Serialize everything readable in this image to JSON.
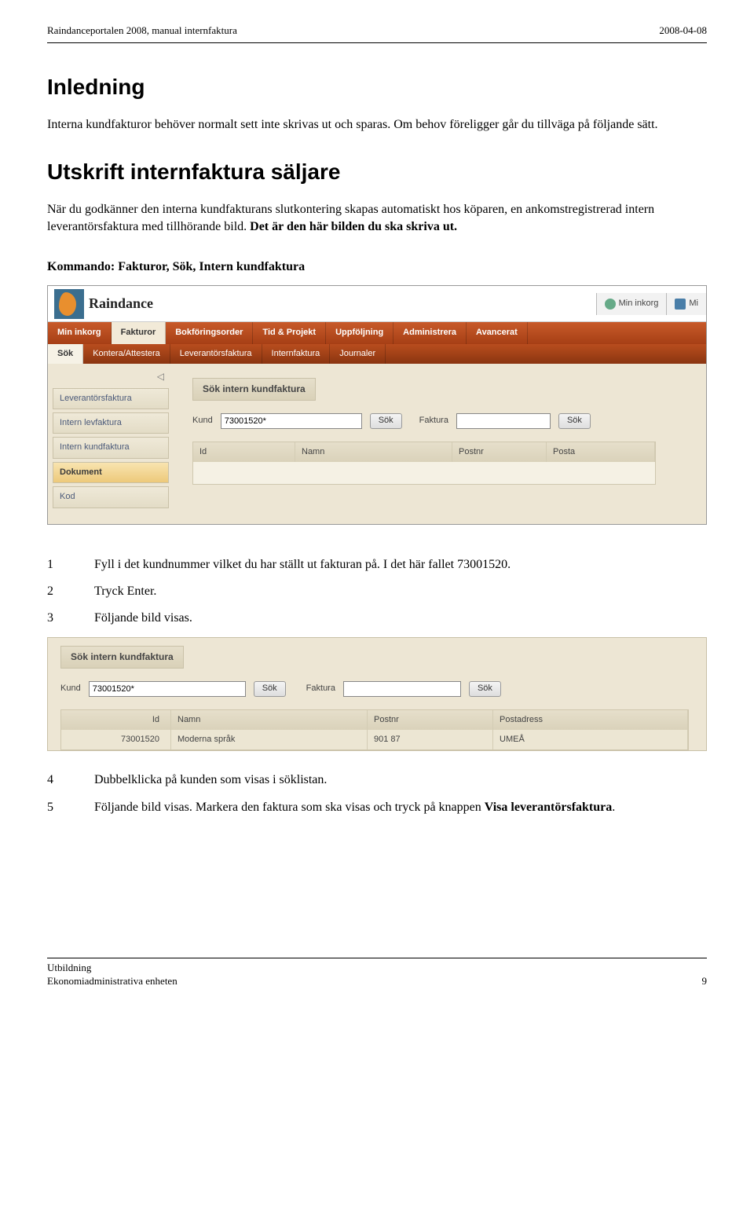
{
  "header": {
    "left": "Raindanceportalen 2008, manual internfaktura",
    "right": "2008-04-08"
  },
  "section1": {
    "title": "Inledning",
    "para": "Interna kundfakturor behöver normalt sett inte skrivas ut och sparas. Om behov föreligger går du tillväga på följande sätt."
  },
  "section2": {
    "title": "Utskrift internfaktura säljare",
    "para_a": "När du godkänner den interna kundfakturans slutkontering skapas automatiskt hos köparen, en ankomstregistrerad intern leverantörsfaktura med tillhörande bild. ",
    "para_b": "Det är den här bilden du ska skriva ut.",
    "kommando": "Kommando: Fakturor, Sök, Intern kundfaktura"
  },
  "shot1": {
    "logo": "Raindance",
    "top_buttons": {
      "inkorg": "Min inkorg",
      "mi": "Mi"
    },
    "mainnav": [
      "Min inkorg",
      "Fakturor",
      "Bokföringsorder",
      "Tid & Projekt",
      "Uppföljning",
      "Administrera",
      "Avancerat"
    ],
    "subnav": [
      "Sök",
      "Kontera/Attestera",
      "Leverantörsfaktura",
      "Internfaktura",
      "Journaler"
    ],
    "side": [
      "Leverantörsfaktura",
      "Intern levfaktura",
      "Intern kundfaktura",
      "Dokument",
      "Kod"
    ],
    "panel_title": "Sök intern kundfaktura",
    "labels": {
      "kund": "Kund",
      "faktura": "Faktura",
      "sok": "Sök"
    },
    "kund_value": "73001520*",
    "grid_headers": {
      "id": "Id",
      "namn": "Namn",
      "postnr": "Postnr",
      "posta": "Posta"
    }
  },
  "steps1": {
    "s1": "Fyll i det kundnummer vilket du har ställt ut fakturan på. I det här fallet 73001520.",
    "s2": "Tryck Enter.",
    "s3": "Följande bild visas."
  },
  "shot2": {
    "panel_title": "Sök intern kundfaktura",
    "labels": {
      "kund": "Kund",
      "faktura": "Faktura",
      "sok": "Sök"
    },
    "kund_value": "73001520*",
    "grid_headers": {
      "id": "Id",
      "namn": "Namn",
      "postnr": "Postnr",
      "posta": "Postadress"
    },
    "row": {
      "id": "73001520",
      "namn": "Moderna språk",
      "postnr": "901 87",
      "posta": "UMEÅ"
    }
  },
  "steps2": {
    "s4": "Dubbelklicka på kunden som visas i söklistan.",
    "s5_a": "Följande bild visas. Markera den faktura som ska visas och tryck på knappen ",
    "s5_b": "Visa leverantörsfaktura",
    "s5_c": "."
  },
  "footer": {
    "line1": "Utbildning",
    "line2": "Ekonomiadministrativa enheten",
    "page": "9"
  }
}
